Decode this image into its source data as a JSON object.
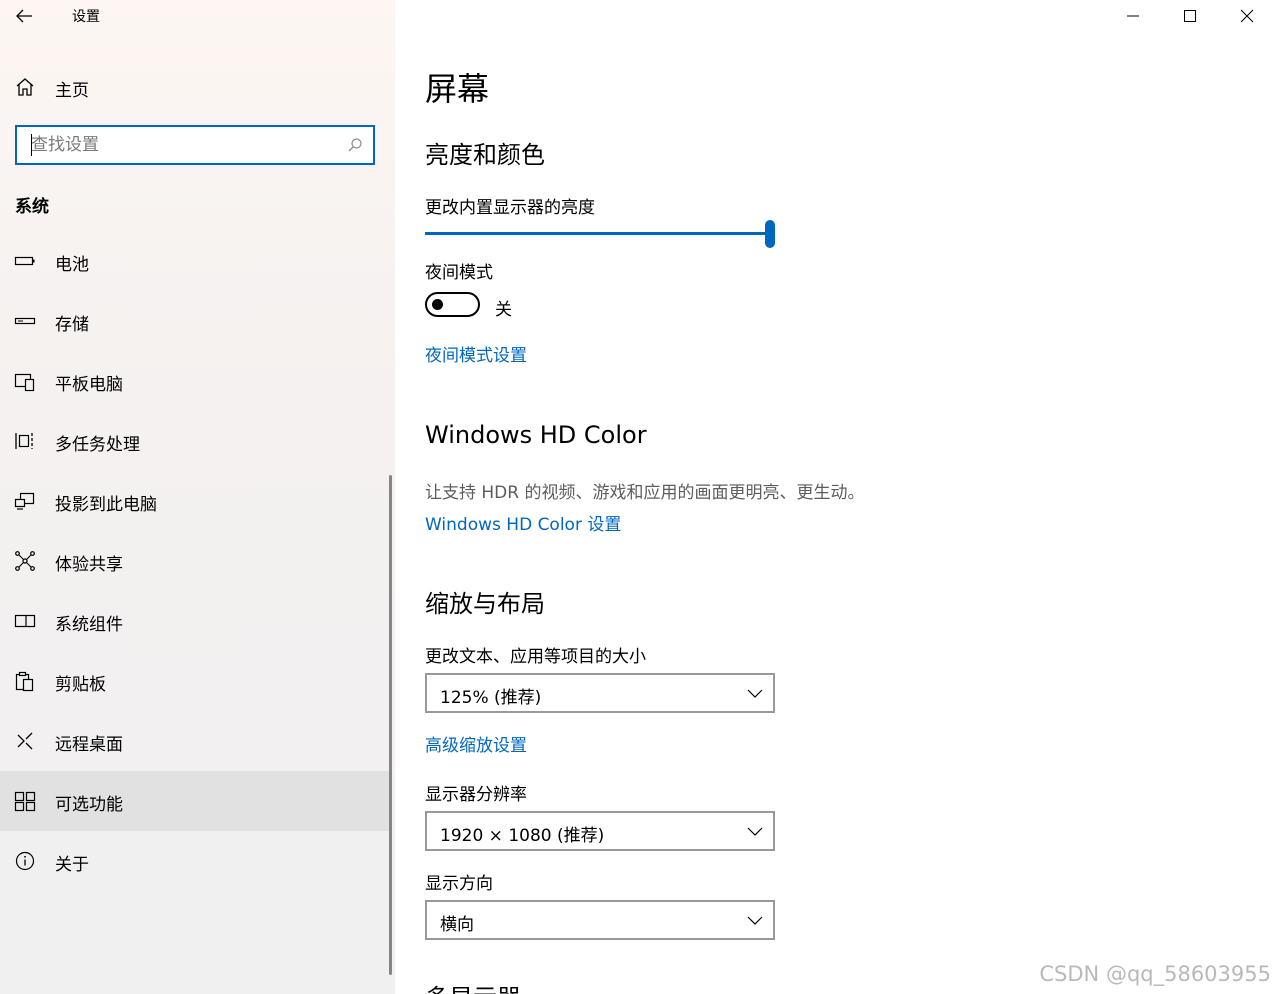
{
  "window": {
    "app_title": "设置",
    "minimize_glyph": "—",
    "maximize_glyph": "☐",
    "close_glyph": "✕"
  },
  "sidebar": {
    "home_label": "主页",
    "search_placeholder": "查找设置",
    "section_title": "系统",
    "items": [
      {
        "label": "电池",
        "icon": "battery-icon"
      },
      {
        "label": "存储",
        "icon": "storage-icon"
      },
      {
        "label": "平板电脑",
        "icon": "tablet-icon"
      },
      {
        "label": "多任务处理",
        "icon": "multitasking-icon"
      },
      {
        "label": "投影到此电脑",
        "icon": "projecting-icon"
      },
      {
        "label": "体验共享",
        "icon": "shared-experiences-icon"
      },
      {
        "label": "系统组件",
        "icon": "system-components-icon"
      },
      {
        "label": "剪贴板",
        "icon": "clipboard-icon"
      },
      {
        "label": "远程桌面",
        "icon": "remote-desktop-icon"
      },
      {
        "label": "可选功能",
        "icon": "optional-features-icon",
        "selected": true
      },
      {
        "label": "关于",
        "icon": "about-icon"
      }
    ]
  },
  "main": {
    "page_title": "屏幕",
    "brightness_section": {
      "title": "亮度和颜色",
      "brightness_label": "更改内置显示器的亮度",
      "brightness_value": 100,
      "night_light_label": "夜间模式",
      "night_light_state": "关",
      "night_light_settings_link": "夜间模式设置"
    },
    "hd_color_section": {
      "title": "Windows HD Color",
      "description": "让支持 HDR 的视频、游戏和应用的画面更明亮、更生动。",
      "settings_link": "Windows HD Color 设置"
    },
    "scale_section": {
      "title": "缩放与布局",
      "scale_label": "更改文本、应用等项目的大小",
      "scale_value": "125% (推荐)",
      "advanced_scaling_link": "高级缩放设置",
      "resolution_label": "显示器分辨率",
      "resolution_value": "1920 × 1080 (推荐)",
      "orientation_label": "显示方向",
      "orientation_value": "横向"
    },
    "multi_display_title": "多显示器"
  },
  "watermark": "CSDN @qq_58603955",
  "colors": {
    "accent": "#0067c0",
    "selected_bg": "#e1e1e1",
    "secondary_text": "#5d5d5d"
  }
}
